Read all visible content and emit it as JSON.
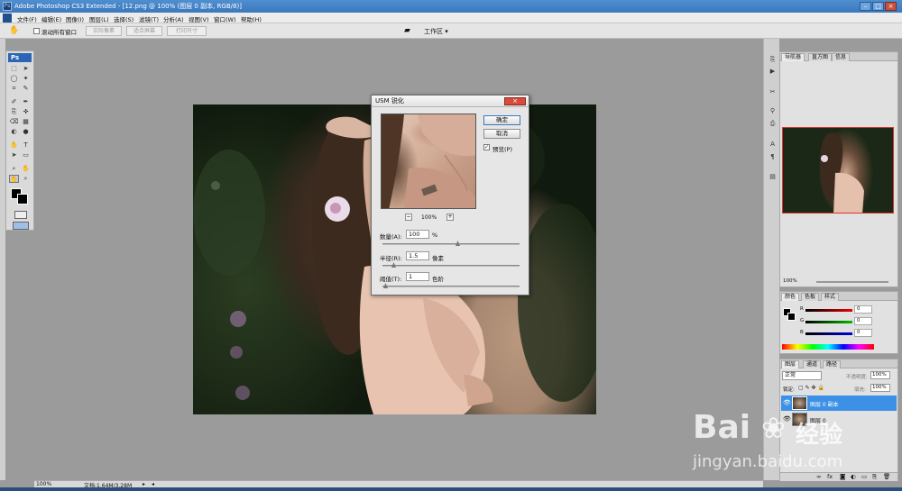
{
  "window": {
    "title": "Adobe Photoshop CS3 Extended - [12.png @ 100% (图层 0 副本, RGB/8)]",
    "app_icon": "Ps"
  },
  "menu": {
    "items": [
      "文件(F)",
      "编辑(E)",
      "图像(I)",
      "图层(L)",
      "选择(S)",
      "滤镜(T)",
      "分析(A)",
      "视图(V)",
      "窗口(W)",
      "帮助(H)"
    ]
  },
  "options": {
    "scroll_all_label": "滚动所有窗口",
    "actual_pixels": "实际像素",
    "fit_screen": "适合屏幕",
    "print_size": "打印尺寸",
    "workspace_label": "工作区 ▾"
  },
  "toolbox": {
    "logo": "Ps",
    "tools": [
      "⬚",
      "➤",
      "◯",
      "✦",
      "⌗",
      "✎",
      "✐",
      "✒",
      "⎘",
      "✜",
      "⌫",
      "▦",
      "◐",
      "●",
      "✋",
      "T",
      "➤",
      "▭",
      "⌕",
      "✋"
    ]
  },
  "dialog": {
    "title": "USM 锐化",
    "ok_label": "确定",
    "cancel_label": "取消",
    "preview_label": "预览(P)",
    "zoom_text": "100%",
    "zoom_out": "−",
    "zoom_in": "+",
    "amount_label": "数量(A):",
    "amount_value": "100",
    "amount_unit": "%",
    "amount_slider_fraction": 0.55,
    "radius_label": "半径(R):",
    "radius_value": "1.5",
    "radius_unit": "像素",
    "radius_slider_fraction": 0.07,
    "threshold_label": "阈值(T):",
    "threshold_value": "1",
    "threshold_unit": "色阶",
    "threshold_slider_fraction": 0.01
  },
  "navigator": {
    "tabs": [
      "导航器",
      "直方图",
      "信息"
    ],
    "zoom_text": "100%"
  },
  "color_panel": {
    "tabs": [
      "颜色",
      "色板",
      "样式"
    ],
    "r_label": "R",
    "r_value": "0",
    "g_label": "G",
    "g_value": "0",
    "b_label": "B",
    "b_value": "0"
  },
  "layers_panel": {
    "tabs": [
      "图层",
      "通道",
      "路径"
    ],
    "blend_mode": "正常",
    "opacity_label": "不透明度:",
    "opacity_value": "100%",
    "lock_label": "锁定:",
    "fill_label": "填充:",
    "fill_value": "100%",
    "layers": [
      {
        "name": "图层 0 副本",
        "selected": true
      },
      {
        "name": "图层 0",
        "selected": false
      }
    ]
  },
  "status": {
    "zoom": "100%",
    "doc_info": "文档:1.64M/3.28M"
  },
  "watermark": {
    "brand": "Bai",
    "brand2": "经验",
    "url": "jingyan.baidu.com"
  },
  "colors": {
    "accent": "#3b78bd",
    "selection": "#3c90e6",
    "close_red": "#d84b3a"
  }
}
